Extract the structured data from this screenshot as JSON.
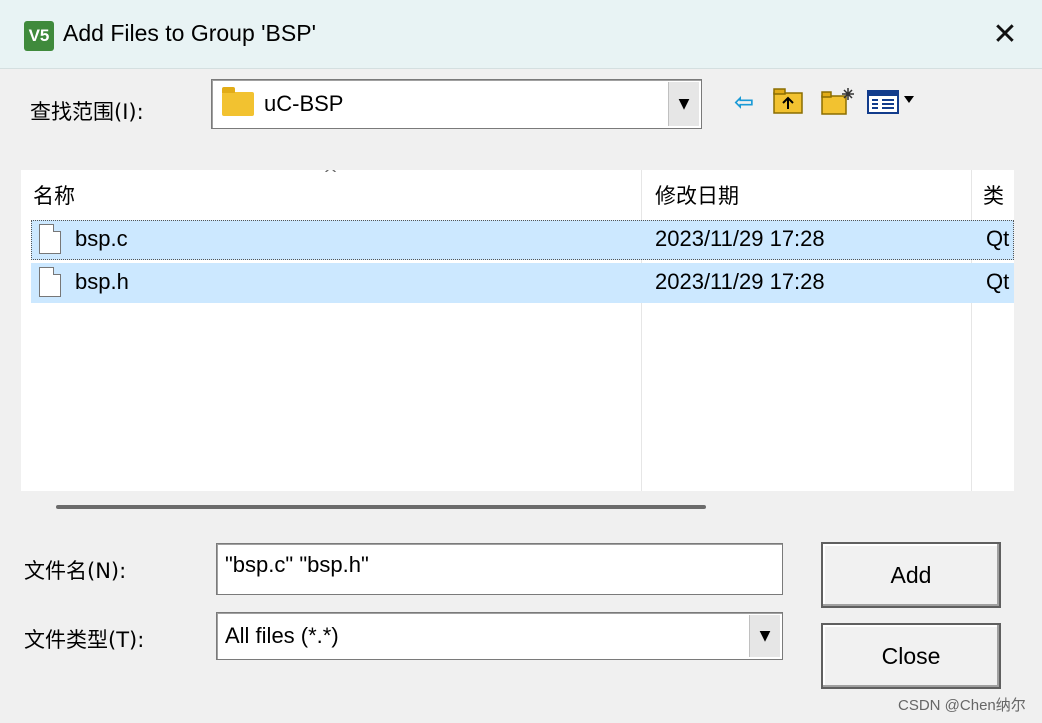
{
  "window": {
    "title": "Add Files to Group 'BSP'",
    "app_icon_text": "V5",
    "close_glyph": "✕"
  },
  "lookin": {
    "label": "查找范围(I):",
    "value": "uC-BSP"
  },
  "toolbar": {
    "back_glyph": "⇦",
    "up_glyph": "⮤",
    "new_folder_glyph": "✳",
    "view_glyph": "▦▾"
  },
  "columns": {
    "name": "名称",
    "modified": "修改日期",
    "type": "类"
  },
  "files": [
    {
      "name": "bsp.c",
      "modified": "2023/11/29 17:28",
      "type": "Qt"
    },
    {
      "name": "bsp.h",
      "modified": "2023/11/29 17:28",
      "type": "Qt"
    }
  ],
  "filename": {
    "label": "文件名(N):",
    "value": "\"bsp.c\" \"bsp.h\""
  },
  "filetype": {
    "label": "文件类型(T):",
    "value": "All files (*.*)"
  },
  "buttons": {
    "add": "Add",
    "close": "Close"
  },
  "watermark": "CSDN @Chen纳尔",
  "colors": {
    "selection": "#cce8ff",
    "titlebar": "#e8f3f4"
  }
}
